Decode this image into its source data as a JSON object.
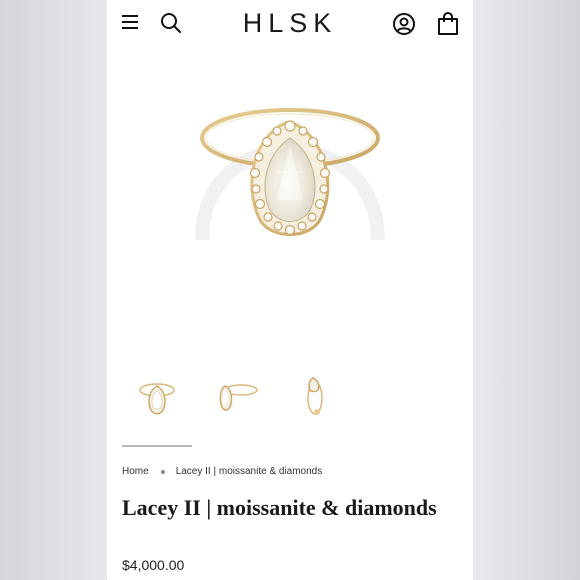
{
  "header": {
    "logo": "HLSK",
    "menu_icon": "hamburger-menu-icon",
    "search_icon": "search-icon",
    "account_icon": "account-icon",
    "cart_icon": "shopping-bag-icon"
  },
  "gallery": {
    "main_image": "ring-main-image",
    "thumbnails": [
      "ring-front-view",
      "ring-angle-view",
      "ring-side-view"
    ],
    "active_thumbnail": 1
  },
  "breadcrumb": {
    "home": "Home",
    "current": "Lacey II | moissanite & diamonds"
  },
  "product": {
    "title": "Lacey II | moissanite & diamonds",
    "price": "$4,000.00"
  },
  "colors": {
    "gold": "#d9b878",
    "stone": "#f1efe6",
    "text": "#1a1a1a"
  }
}
